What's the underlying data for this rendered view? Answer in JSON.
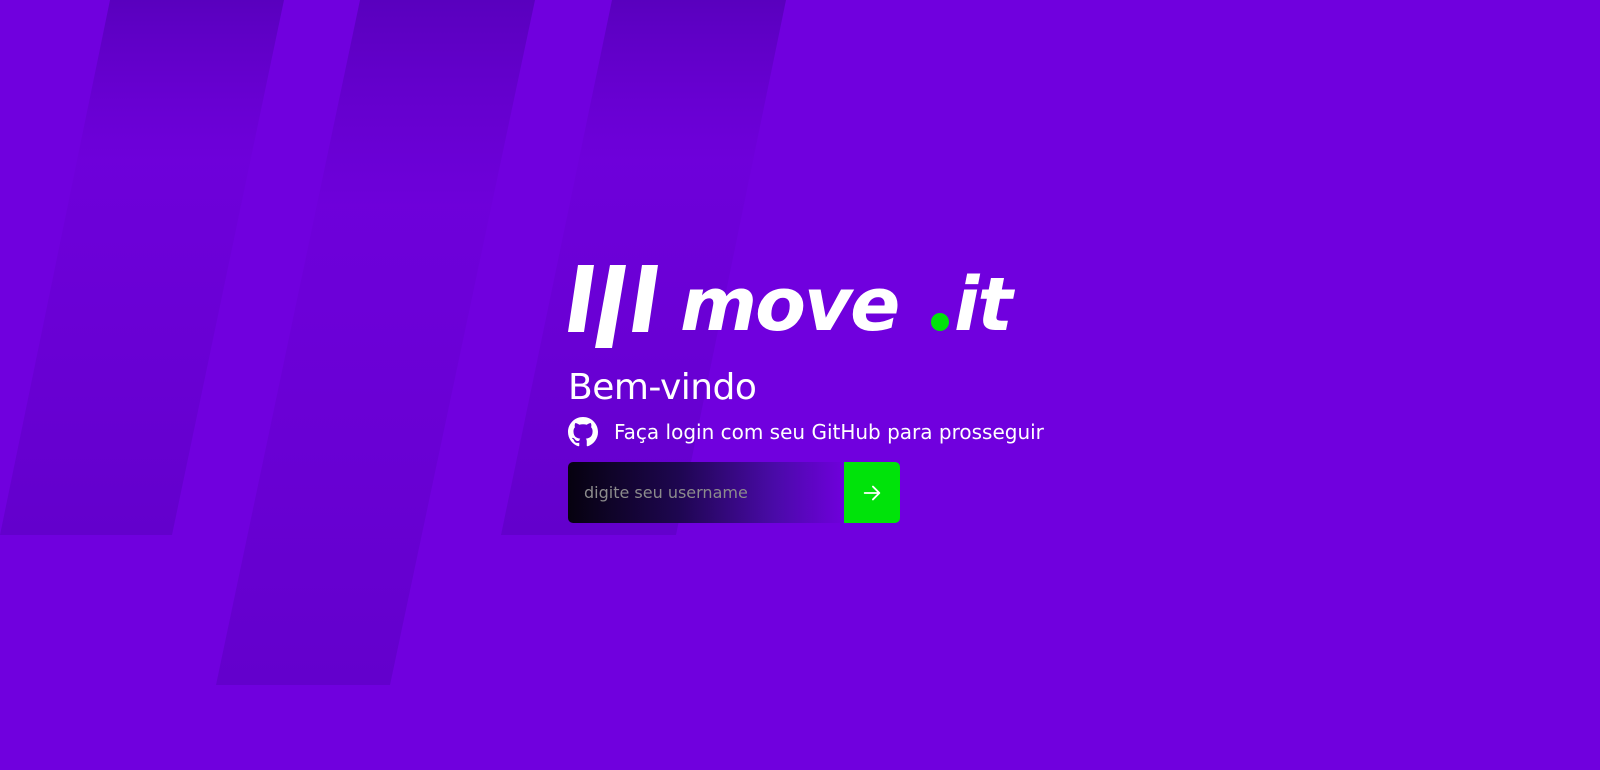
{
  "brand": {
    "name": "move.it",
    "logo_text_main": "move",
    "logo_text_dot": ".",
    "logo_text_tail": "it",
    "logo_icon": "three-slanted-bars-logo-icon",
    "colors": {
      "background": "#7000de",
      "accent_green": "#00e30a",
      "text": "#ffffff"
    }
  },
  "login": {
    "heading": "Bem-vindo",
    "subtitle": "Faça login com seu GitHub para prosseguir",
    "subtitle_icon": "github-icon",
    "username_placeholder": "digite seu username",
    "username_value": "",
    "submit_icon": "arrow-right-icon"
  }
}
